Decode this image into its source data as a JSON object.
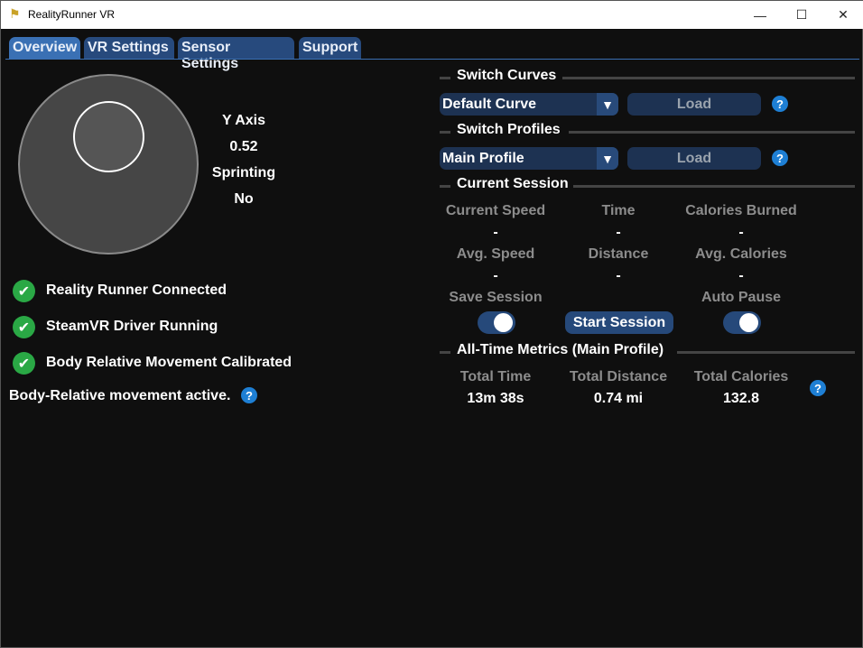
{
  "window": {
    "title": "RealityRunner VR",
    "minimize": "—",
    "maximize": "☐",
    "close": "✕"
  },
  "tabs": [
    {
      "label": "Overview"
    },
    {
      "label": "VR Settings"
    },
    {
      "label": "Sensor Settings"
    },
    {
      "label": "Support"
    }
  ],
  "joystick": {
    "y_axis_label": "Y Axis",
    "y_axis_value": "0.52",
    "sprinting_label": "Sprinting",
    "sprinting_value": "No"
  },
  "status": [
    {
      "label": "Reality Runner Connected"
    },
    {
      "label": "SteamVR Driver Running"
    },
    {
      "label": "Body Relative Movement Calibrated"
    }
  ],
  "body_relative_text": "Body-Relative movement active.",
  "help_glyph": "?",
  "switch_curves": {
    "title": "Switch Curves",
    "selected": "Default Curve",
    "load": "Load"
  },
  "switch_profiles": {
    "title": "Switch Profiles",
    "selected": "Main Profile",
    "load": "Load"
  },
  "current_session": {
    "title": "Current Session",
    "row1": [
      {
        "label": "Current Speed",
        "value": "-"
      },
      {
        "label": "Time",
        "value": "-"
      },
      {
        "label": "Calories Burned",
        "value": "-"
      }
    ],
    "row2": [
      {
        "label": "Avg. Speed",
        "value": "-"
      },
      {
        "label": "Distance",
        "value": "-"
      },
      {
        "label": "Avg. Calories",
        "value": "-"
      }
    ],
    "save_session": "Save Session",
    "start_session": "Start Session",
    "auto_pause": "Auto Pause"
  },
  "all_time": {
    "title": "All-Time Metrics (Main Profile)",
    "metrics": [
      {
        "label": "Total Time",
        "value": "13m 38s"
      },
      {
        "label": "Total Distance",
        "value": "0.74 mi"
      },
      {
        "label": "Total Calories",
        "value": "132.8"
      }
    ]
  },
  "colors": {
    "accent": "#3a70b4",
    "success": "#2aa845",
    "help": "#1e7fd4"
  }
}
